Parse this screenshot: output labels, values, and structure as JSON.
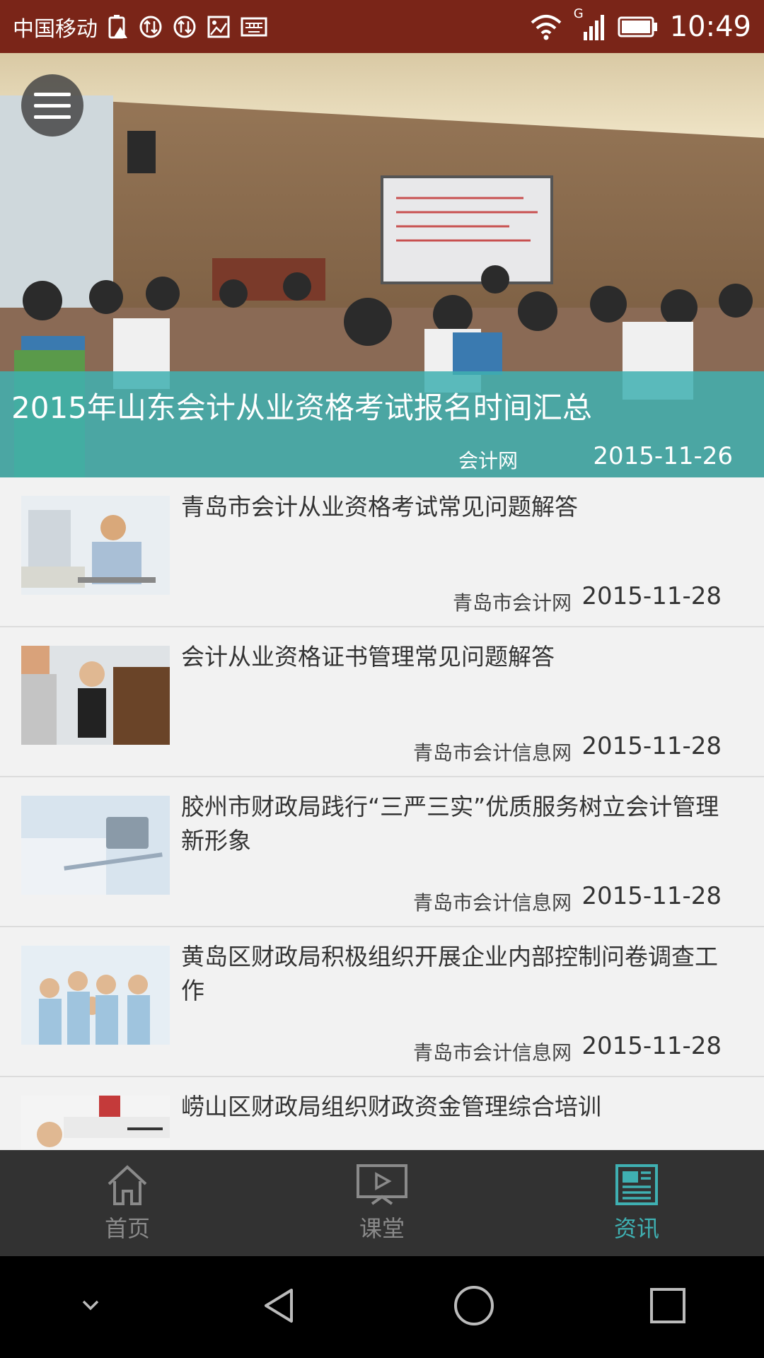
{
  "status_bar": {
    "carrier": "中国移动",
    "time": "10:49",
    "signal_label": "G"
  },
  "hero": {
    "title": "2015年山东会计从业资格考试报名时间汇总",
    "source": "会计网",
    "date": "2015-11-26"
  },
  "news": [
    {
      "title": "青岛市会计从业资格考试常见问题解答",
      "source": "青岛市会计网",
      "date": "2015-11-28"
    },
    {
      "title": "会计从业资格证书管理常见问题解答",
      "source": "青岛市会计信息网",
      "date": "2015-11-28"
    },
    {
      "title": "胶州市财政局践行“三严三实”优质服务树立会计管理新形象",
      "source": "青岛市会计信息网",
      "date": "2015-11-28"
    },
    {
      "title": "黄岛区财政局积极组织开展企业内部控制问卷调查工作",
      "source": "青岛市会计信息网",
      "date": "2015-11-28"
    },
    {
      "title": "崂山区财政局组织财政资金管理综合培训",
      "source": "",
      "date": ""
    }
  ],
  "tabs": [
    {
      "label": "首页",
      "icon": "home-icon",
      "active": false
    },
    {
      "label": "课堂",
      "icon": "classroom-icon",
      "active": false
    },
    {
      "label": "资讯",
      "icon": "news-icon",
      "active": true
    }
  ],
  "colors": {
    "status_bar": "#7a2518",
    "accent": "#3fb0b2",
    "tab_bar": "#323232"
  }
}
